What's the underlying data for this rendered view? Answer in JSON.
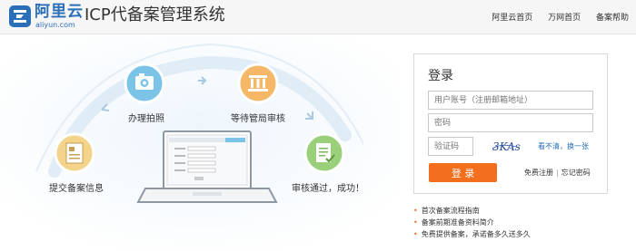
{
  "header": {
    "logo_cn": "阿里云",
    "logo_en": "aliyun.com",
    "title": "ICP代备案管理系统",
    "nav": [
      "阿里云首页",
      "万网首页",
      "备案帮助"
    ]
  },
  "hero": {
    "steps": [
      "提交备案信息",
      "办理拍照",
      "等待管局审核",
      "审核通过，成功！"
    ],
    "icons": [
      "document-icon",
      "camera-icon",
      "building-icon",
      "approval-icon"
    ],
    "colors": {
      "yellow": "#f3d48a",
      "blue": "#7cc3e8",
      "orange": "#f6b766",
      "green": "#9bd07a"
    }
  },
  "login": {
    "title": "登录",
    "username_placeholder": "用户账号（注册邮箱地址）",
    "password_placeholder": "密码",
    "captcha_placeholder": "验证码",
    "captcha_text": "3KAs",
    "refresh": "看不清，换一张",
    "button": "登 录",
    "register": "免费注册",
    "forgot": "忘记密码",
    "accent": "#f36e1d"
  },
  "help": [
    "首次备案流程指南",
    "备案前期准备资料简介",
    "免费提供备案，承诺备多久送多久"
  ]
}
